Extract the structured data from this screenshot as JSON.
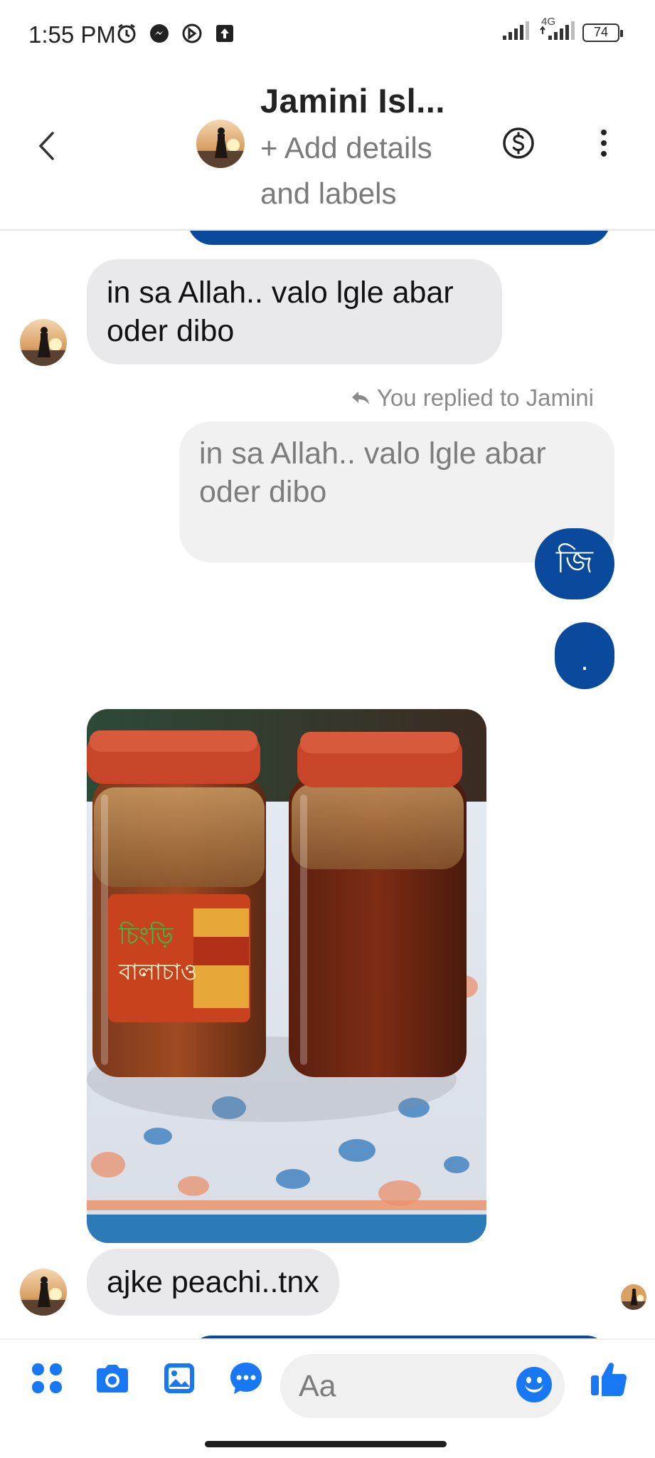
{
  "status_bar": {
    "time": "1:55 PM",
    "network": "4G",
    "battery": "74",
    "icons": [
      "alarm-icon",
      "messenger-icon",
      "sync-icon",
      "upload-icon",
      "signal-icon",
      "signal-4g-icon",
      "battery-icon"
    ]
  },
  "header": {
    "contact_name": "Jamini Isl...",
    "subtitle": "+ Add details and labels",
    "icons": [
      "back-chevron-icon",
      "dollar-icon",
      "more-vertical-icon"
    ]
  },
  "messages": {
    "incoming_1": "in sa Allah.. valo lgle abar oder dibo",
    "reply_meta": "You replied to Jamini",
    "quoted_text": "in sa Allah.. valo lgle abar oder dibo",
    "outgoing_1": "জি",
    "outgoing_2": ".",
    "incoming_photo": "photo of two jars of pickle",
    "incoming_2": "ajke peachi..tnx"
  },
  "composer": {
    "placeholder": "Aa",
    "icons": [
      "apps-icon",
      "camera-icon",
      "gallery-icon",
      "chat-bubble-icon",
      "emoji-icon",
      "like-icon"
    ]
  },
  "colors": {
    "accent": "#1878f3",
    "outgoing_bubble": "#0a4a9c",
    "incoming_bubble": "#e9e9eb"
  }
}
